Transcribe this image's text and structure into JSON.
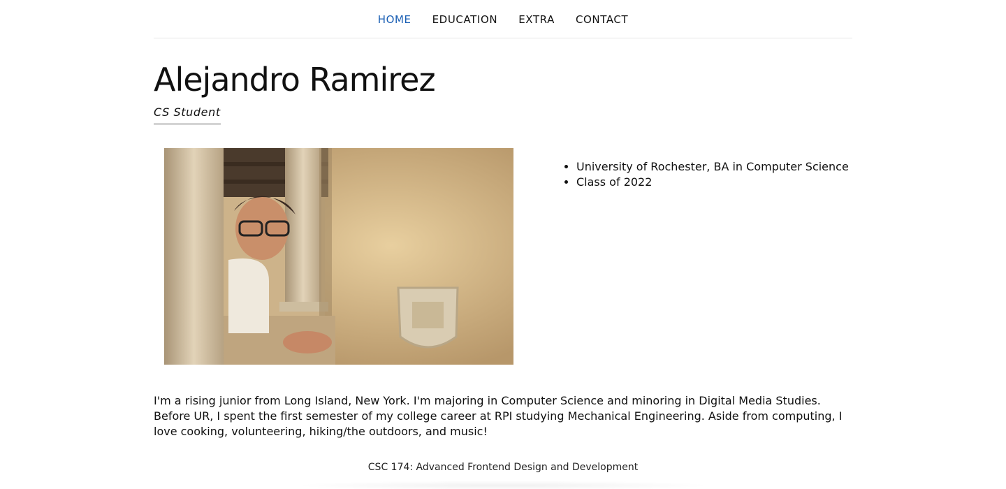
{
  "nav": {
    "items": [
      {
        "label": "HOME",
        "active": true
      },
      {
        "label": "EDUCATION",
        "active": false
      },
      {
        "label": "EXTRA",
        "active": false
      },
      {
        "label": "CONTACT",
        "active": false
      }
    ]
  },
  "header": {
    "name": "Alejandro Ramirez",
    "subtitle": "CS Student"
  },
  "facts": [
    "University of Rochester, BA in Computer Science",
    "Class of 2022"
  ],
  "bio": "I'm a rising junior from Long Island, New York. I'm majoring in Computer Science and minoring in Digital Media Studies. Before UR, I spent the first semester of my college career at RPI studying Mechanical Engineering. Aside from computing, I love cooking, volunteering, hiking/the outdoors, and music!",
  "footer": {
    "text": "CSC 174: Advanced Frontend Design and Development"
  },
  "colors": {
    "nav_active": "#1a5fb4",
    "text": "#111111"
  }
}
